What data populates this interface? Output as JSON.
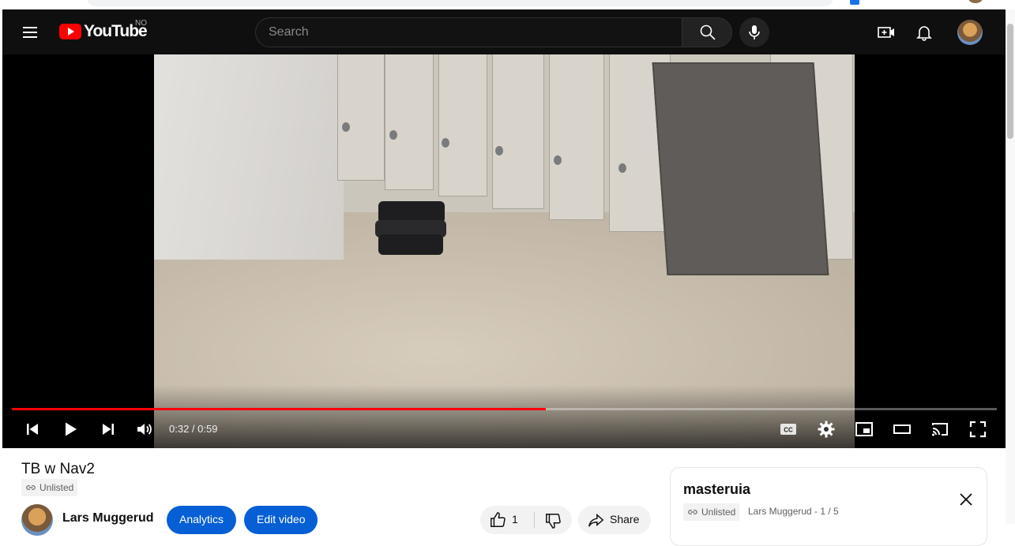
{
  "header": {
    "logo_text": "YouTube",
    "region": "NO",
    "search_placeholder": "Search",
    "icons": [
      "menu-icon",
      "search-icon",
      "mic-icon",
      "create-icon",
      "bell-icon",
      "avatar"
    ]
  },
  "player": {
    "current_time": "0:32",
    "duration": "0:59",
    "time_label": "0:32 / 0:59",
    "progress_fraction": 0.542,
    "controls": [
      "previous-icon",
      "play-icon",
      "next-icon",
      "volume-icon",
      "cc-icon",
      "settings-icon",
      "miniplayer-icon",
      "theater-icon",
      "cast-icon",
      "fullscreen-icon"
    ]
  },
  "video": {
    "title": "TB w Nav2",
    "visibility": "Unlisted",
    "channel_name": "Lars Muggerud",
    "analytics_label": "Analytics",
    "edit_label": "Edit video",
    "like_count": "1",
    "share_label": "Share"
  },
  "playlist": {
    "title": "masteruia",
    "visibility": "Unlisted",
    "meta": "Lars Muggerud - 1 / 5"
  },
  "colors": {
    "header_bg": "#0f0f0f",
    "brand_red": "#ff0000",
    "progress_red": "#ff0000",
    "accent_blue": "#065fd4"
  }
}
